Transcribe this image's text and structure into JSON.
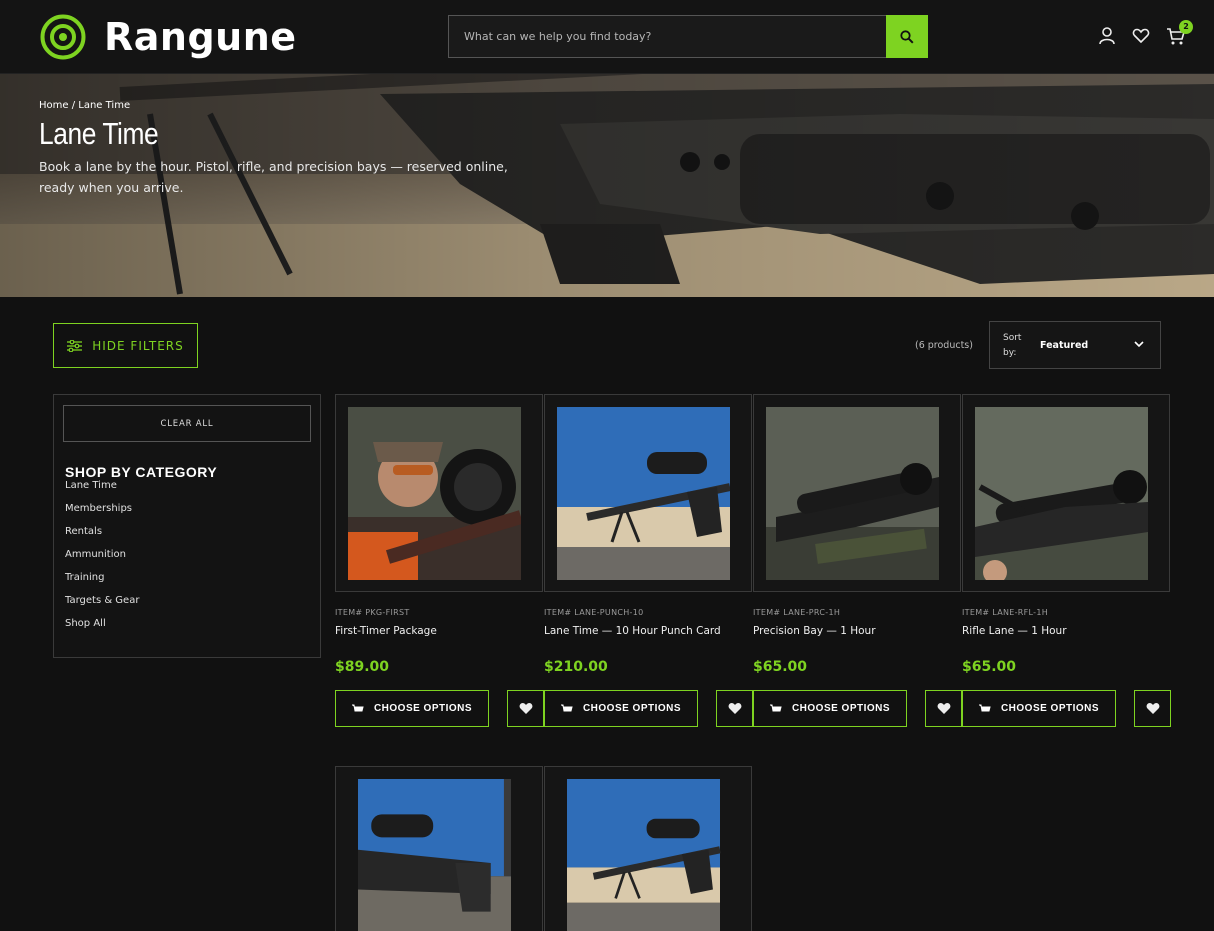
{
  "header": {
    "brand": "Rangune",
    "search_placeholder": "What can we help you find today?",
    "cart_count": "2",
    "icons": [
      "account-icon",
      "heart-icon",
      "cart-icon"
    ],
    "accent_color": "#7ed321"
  },
  "hero": {
    "breadcrumb_home": "Home",
    "breadcrumb_sep": " / ",
    "breadcrumb_current": "Lane Time",
    "title": "Lane Time",
    "description": "Book a lane by the hour. Pistol, rifle, and precision bays — reserved online, ready when you arrive."
  },
  "toolbar": {
    "filters_label": "HIDE FILTERS",
    "product_count": "(6 products)",
    "sort_label": "Sort by:",
    "sort_value": "Featured"
  },
  "sidebar": {
    "clear_all": "CLEAR ALL",
    "category_title": "SHOP BY CATEGORY",
    "categories": [
      "Lane Time",
      "Memberships",
      "Rentals",
      "Ammunition",
      "Training",
      "Targets & Gear",
      "Shop All"
    ]
  },
  "products": [
    {
      "sku": "ITEM# PKG-FIRST",
      "name": "First-Timer Package",
      "price": "$89.00",
      "button": "CHOOSE OPTIONS"
    },
    {
      "sku": "ITEM# LANE-PUNCH-10",
      "name": "Lane Time — 10 Hour Punch Card",
      "price": "$210.00",
      "button": "CHOOSE OPTIONS"
    },
    {
      "sku": "ITEM# LANE-PRC-1H",
      "name": "Precision Bay — 1 Hour",
      "price": "$65.00",
      "button": "CHOOSE OPTIONS"
    },
    {
      "sku": "ITEM# LANE-RFL-1H",
      "name": "Rifle Lane — 1 Hour",
      "price": "$65.00",
      "button": "CHOOSE OPTIONS"
    }
  ]
}
